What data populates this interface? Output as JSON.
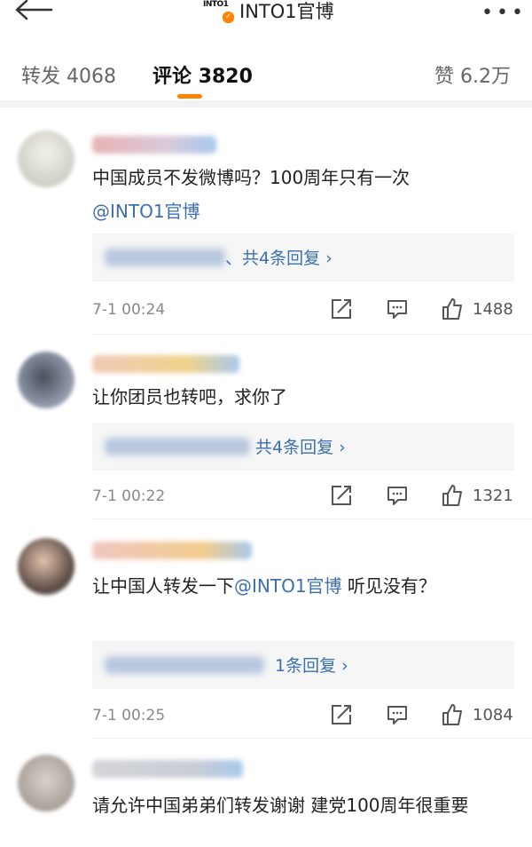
{
  "header": {
    "back_icon": "back-arrow-icon",
    "logo_text": "INTO1",
    "verified_badge": "✓",
    "account_name": "INTO1官博",
    "more_icon": "more-dots-icon"
  },
  "tabs": {
    "forward_label": "转发",
    "forward_count": "4068",
    "comment_label": "评论",
    "comment_count": "3820",
    "like_label": "赞",
    "like_count": "6.2万",
    "active_color": "#ff8200"
  },
  "comments": [
    {
      "text_before": "中国成员不发微博吗？100周年只有一次",
      "mention": "@INTO1官博",
      "text_after": "",
      "reply_link": "、共4条回复 ›",
      "time": "7-1 00:24",
      "likes": "1488"
    },
    {
      "text_before": "让你团员也转吧，求你了",
      "mention": "",
      "text_after": "",
      "reply_link": "共4条回复 ›",
      "time": "7-1 00:22",
      "likes": "1321"
    },
    {
      "text_before": "让中国人转发一下",
      "mention": "@INTO1官博",
      "text_after": " 听见没有？",
      "reply_link": "1条回复 ›",
      "time": "7-1 00:25",
      "likes": "1084"
    },
    {
      "text_before": "请允许中国弟弟们转发谢谢 建党100周年很重要",
      "mention": "",
      "text_after": "",
      "reply_link": "",
      "time": "",
      "likes": ""
    }
  ],
  "colors": {
    "mention": "#3c6fb0",
    "accent": "#ff8200"
  }
}
